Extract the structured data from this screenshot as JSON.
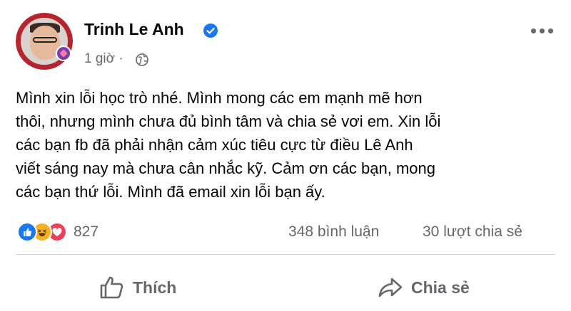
{
  "post": {
    "author": "Trinh Le Anh",
    "time": "1 giờ",
    "separator": "·",
    "verified_icon": "verified-badge-icon",
    "privacy_icon": "globe-icon",
    "lines": [
      "Mình xin lỗi học trò nhé. Mình mong các em mạnh mẽ hơn",
      "thôi, nhưng mình chưa đủ bình tâm và chia sẻ vơi em. Xin lỗi",
      "các bạn fb đã phải nhận cảm xúc tiêu cực từ điều Lê Anh",
      "viết sáng nay mà chưa cân nhắc kỹ. Cảm ơn các bạn, mong",
      "các bạn thứ lỗi. Mình đã email xin lỗi bạn ấy."
    ]
  },
  "stats": {
    "reaction_icons": [
      "like-icon",
      "haha-icon",
      "love-icon"
    ],
    "reaction_count": "827",
    "comments": "348 bình luận",
    "shares": "30 lượt chia sẻ"
  },
  "actions": {
    "like_label": "Thích",
    "share_label": "Chia sẻ"
  },
  "colors": {
    "accent": "#1877f2",
    "secondary_text": "#65676b",
    "primary_text": "#050505",
    "divider": "#ced0d4"
  }
}
